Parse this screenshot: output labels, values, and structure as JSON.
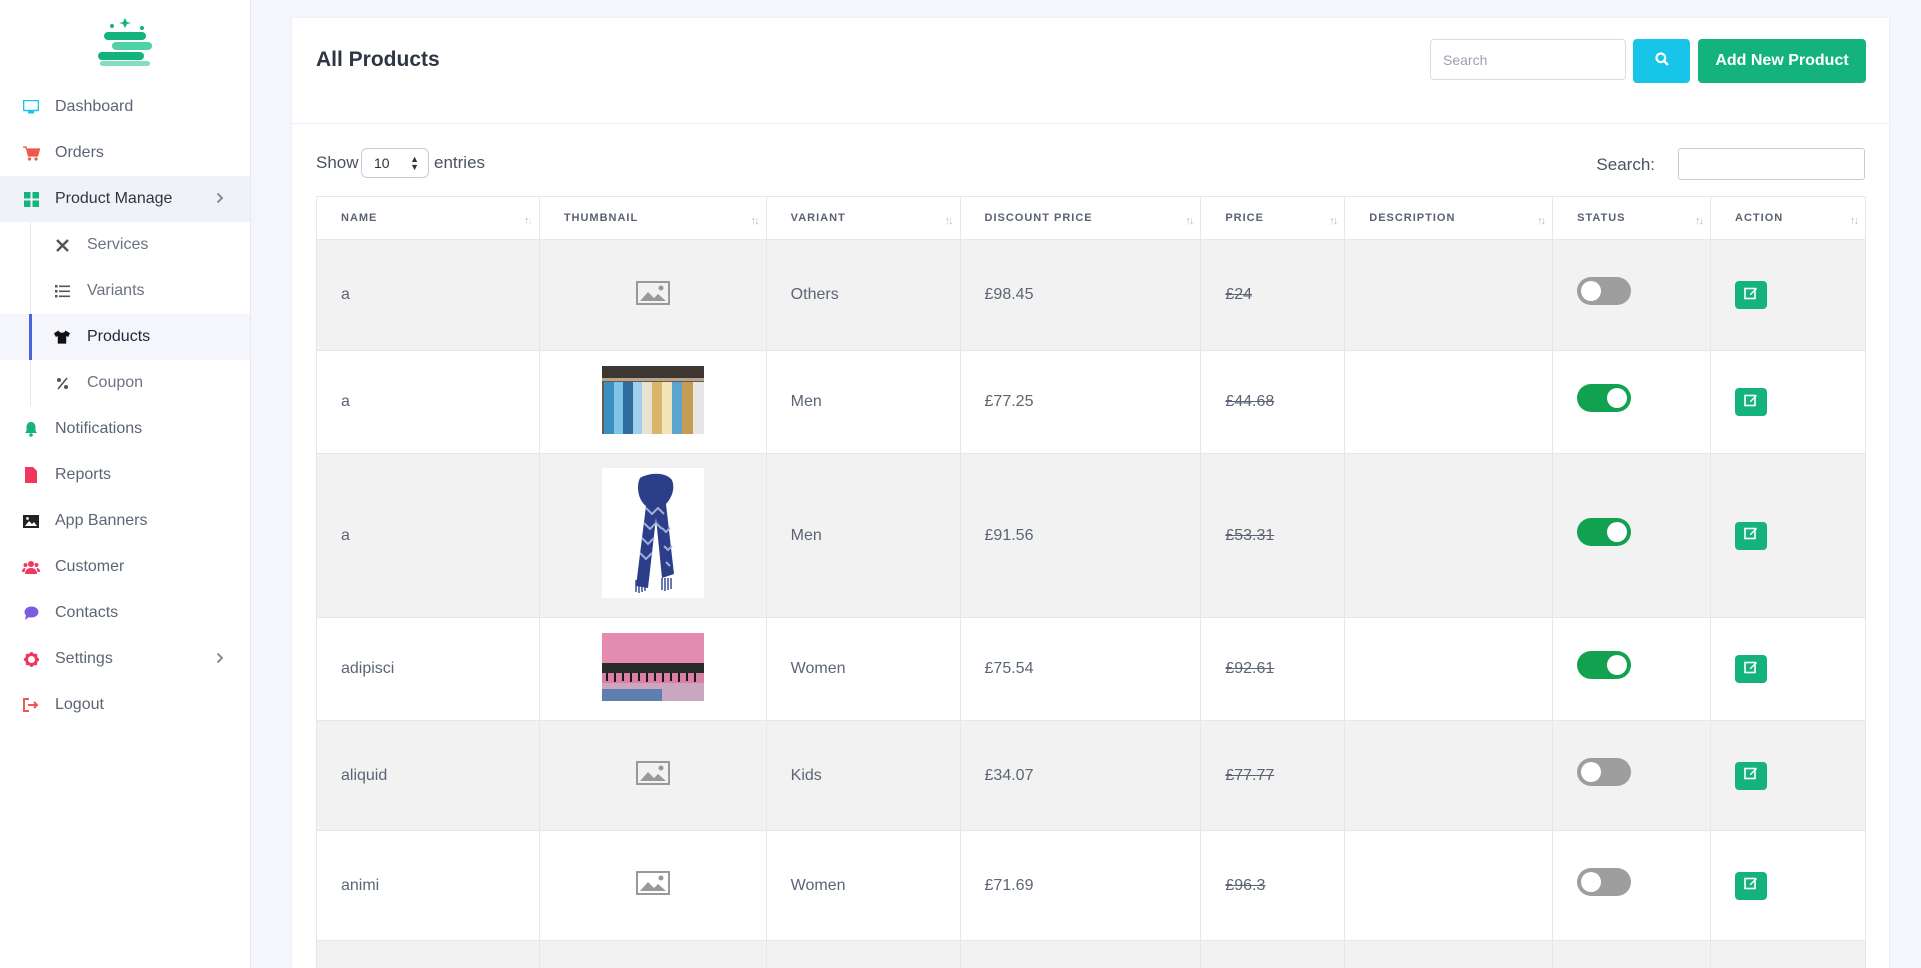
{
  "sidebar": {
    "items": [
      {
        "label": "Dashboard",
        "icon": "monitor-icon",
        "color": "#16c5e8"
      },
      {
        "label": "Orders",
        "icon": "cart-icon",
        "color": "#f1584d"
      },
      {
        "label": "Product Manage",
        "icon": "grid-icon",
        "color": "#14b37d"
      },
      {
        "label": "Notifications",
        "icon": "bell-icon",
        "color": "#14b37d"
      },
      {
        "label": "Reports",
        "icon": "file-icon",
        "color": "#f0375e"
      },
      {
        "label": "App Banners",
        "icon": "image-icon",
        "color": "#222"
      },
      {
        "label": "Customer",
        "icon": "users-icon",
        "color": "#f0375e"
      },
      {
        "label": "Contacts",
        "icon": "chat-icon",
        "color": "#7b5ce0"
      },
      {
        "label": "Settings",
        "icon": "gear-icon",
        "color": "#f0375e"
      },
      {
        "label": "Logout",
        "icon": "logout-icon",
        "color": "#f1584d"
      }
    ],
    "sub_items": [
      {
        "label": "Services",
        "icon": "tools-icon"
      },
      {
        "label": "Variants",
        "icon": "list-icon"
      },
      {
        "label": "Products",
        "icon": "tshirt-icon"
      },
      {
        "label": "Coupon",
        "icon": "percent-icon"
      }
    ]
  },
  "header": {
    "title": "All Products",
    "search_placeholder": "Search",
    "add_button": "Add New Product"
  },
  "controls": {
    "show": "Show",
    "entries_value": "10",
    "entries": "entries",
    "search": "Search:"
  },
  "table": {
    "columns": [
      "Name",
      "Thumbnail",
      "Variant",
      "Discount Price",
      "Price",
      "Description",
      "Status",
      "Action"
    ],
    "rows": [
      {
        "name": "a",
        "thumb": "placeholder-icon",
        "variant": "Others",
        "discount": "£98.45",
        "price": "£24",
        "description": "",
        "status": false
      },
      {
        "name": "a",
        "thumb": "clothes-rack-photo",
        "variant": "Men",
        "discount": "£77.25",
        "price": "£44.68",
        "description": "",
        "status": true
      },
      {
        "name": "a",
        "thumb": "scarf-photo",
        "variant": "Men",
        "discount": "£91.56",
        "price": "£53.31",
        "description": "",
        "status": true
      },
      {
        "name": "adipisci",
        "thumb": "pink-fabric-photo",
        "variant": "Women",
        "discount": "£75.54",
        "price": "£92.61",
        "description": "",
        "status": true
      },
      {
        "name": "aliquid",
        "thumb": "placeholder-icon",
        "variant": "Kids",
        "discount": "£34.07",
        "price": "£77.77",
        "description": "",
        "status": false
      },
      {
        "name": "animi",
        "thumb": "placeholder-icon",
        "variant": "Women",
        "discount": "£71.69",
        "price": "£96.3",
        "description": "",
        "status": false
      }
    ]
  }
}
